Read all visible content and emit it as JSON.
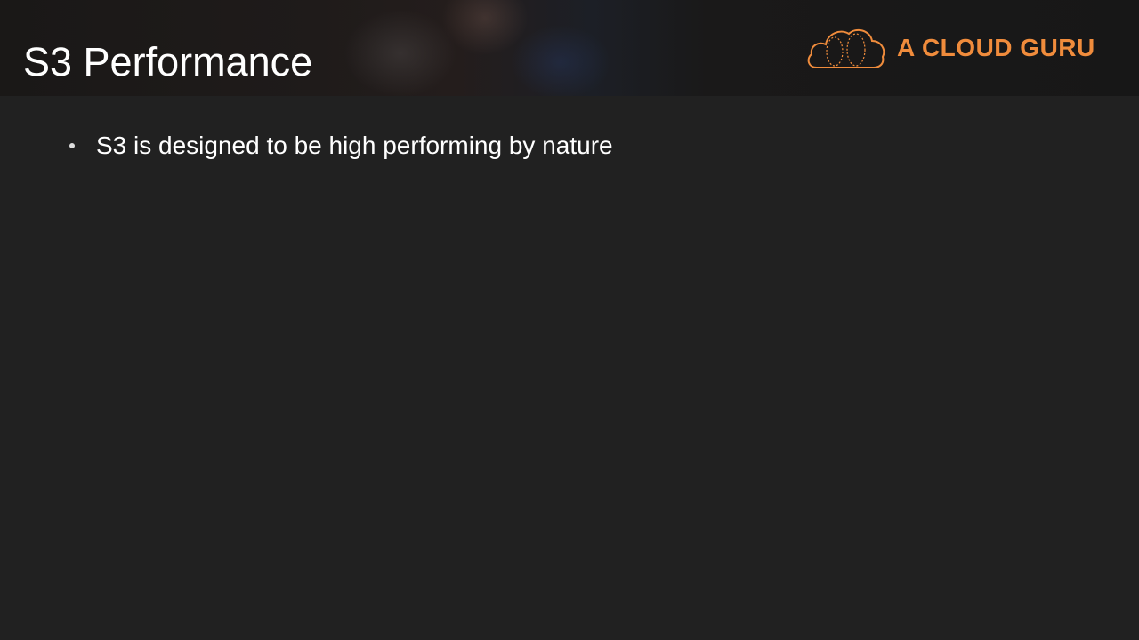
{
  "slide": {
    "title": "S3 Performance",
    "bullets": [
      "S3 is designed to be high performing by nature"
    ]
  },
  "logo": {
    "text": "A CLOUD GURU",
    "icon": "cloud-icon",
    "color": "#f08c3c"
  },
  "colors": {
    "background": "#212121",
    "title": "#ffffff",
    "accent": "#f08c3c"
  }
}
